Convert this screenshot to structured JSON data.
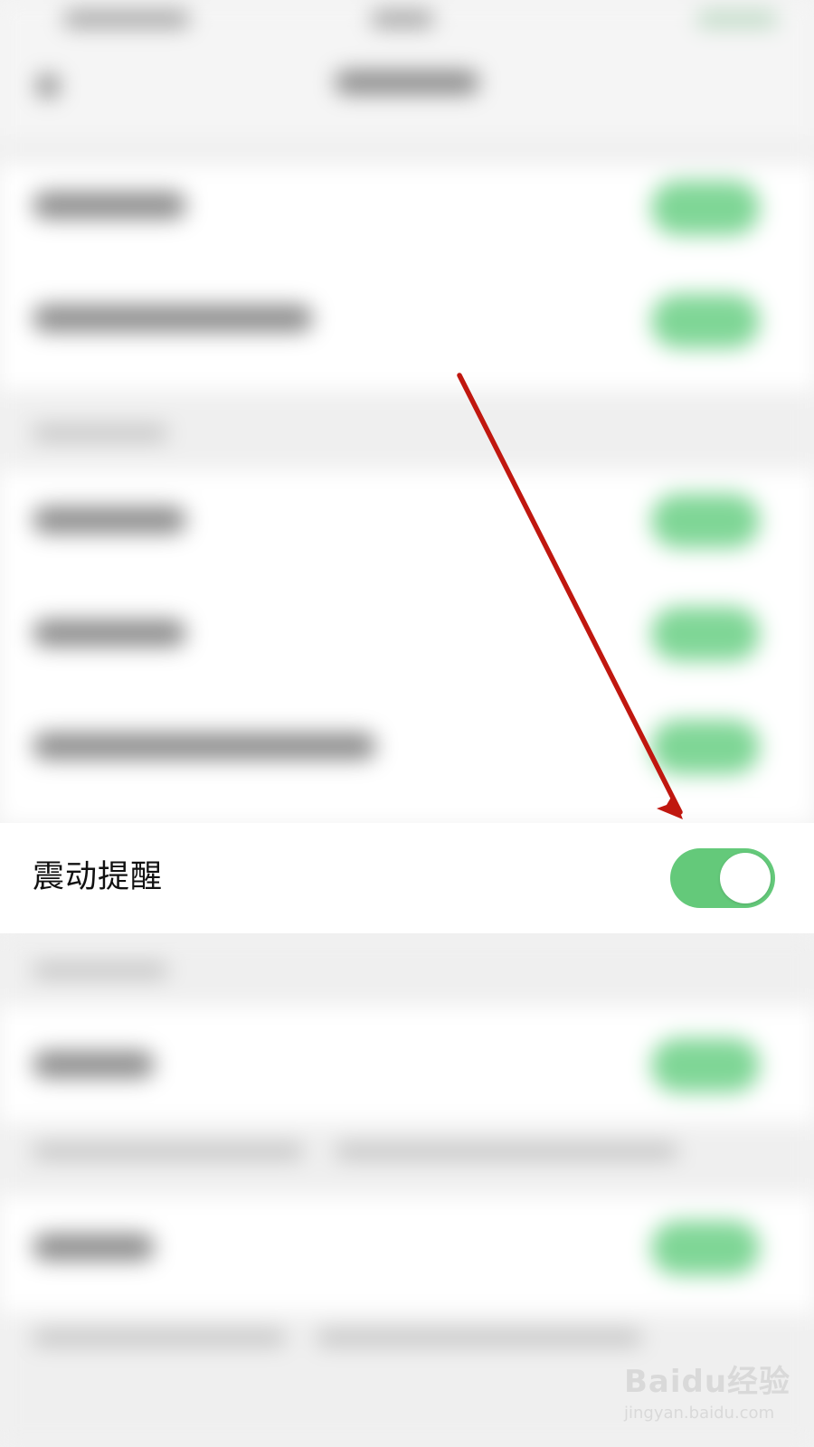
{
  "setting": {
    "label": "震动提醒",
    "enabled": true
  },
  "colors": {
    "toggle_on": "#64c97a",
    "arrow": "#c0170f",
    "row_background": "#ffffff",
    "page_background": "#f2f2f2"
  },
  "watermark": {
    "logo": "Baidu经验",
    "url": "jingyan.baidu.com"
  }
}
